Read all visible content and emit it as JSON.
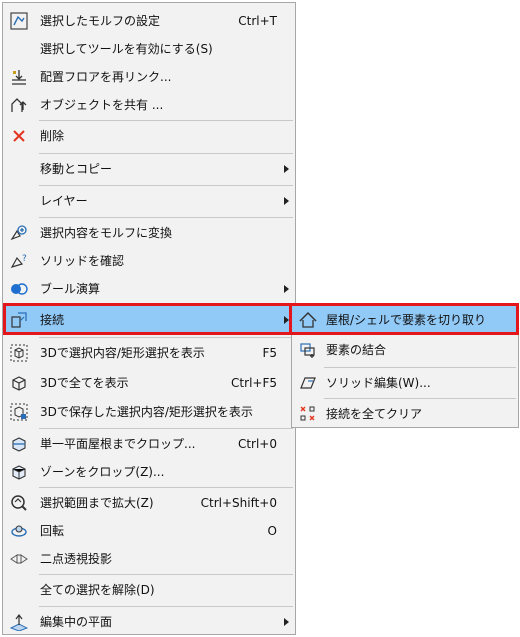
{
  "menu": {
    "items": [
      {
        "label": "選択したモルフの設定",
        "shortcut": "Ctrl+T",
        "icon": "morph-settings-icon"
      },
      {
        "label": "選択してツールを有効にする(S)",
        "shortcut": "",
        "icon": ""
      },
      {
        "label": "配置フロアを再リンク...",
        "shortcut": "",
        "icon": "relink-floor-icon"
      },
      {
        "label": "オブジェクトを共有 ...",
        "shortcut": "",
        "icon": "share-object-icon"
      },
      {
        "label": "削除",
        "shortcut": "",
        "icon": "delete-icon"
      },
      {
        "label": "移動とコピー",
        "shortcut": "",
        "icon": ""
      },
      {
        "label": "レイヤー",
        "shortcut": "",
        "icon": ""
      },
      {
        "label": "選択内容をモルフに変換",
        "shortcut": "",
        "icon": "convert-morph-icon"
      },
      {
        "label": "ソリッドを確認",
        "shortcut": "",
        "icon": "check-solid-icon"
      },
      {
        "label": "ブール演算",
        "shortcut": "",
        "icon": "boolean-icon"
      },
      {
        "label": "接続",
        "shortcut": "",
        "icon": "connect-icon"
      },
      {
        "label": "3Dで選択内容/矩形選択を表示",
        "shortcut": "F5",
        "icon": "3d-selection-icon"
      },
      {
        "label": "3Dで全てを表示",
        "shortcut": "Ctrl+F5",
        "icon": "3d-all-icon"
      },
      {
        "label": "3Dで保存した選択内容/矩形選択を表示",
        "shortcut": "",
        "icon": "3d-saved-selection-icon"
      },
      {
        "label": "単一平面屋根までクロップ...",
        "shortcut": "Ctrl+0",
        "icon": "crop-roof-icon"
      },
      {
        "label": "ゾーンをクロップ(Z)...",
        "shortcut": "",
        "icon": "crop-zone-icon"
      },
      {
        "label": "選択範囲まで拡大(Z)",
        "shortcut": "Ctrl+Shift+0",
        "icon": "zoom-selection-icon"
      },
      {
        "label": "回転",
        "shortcut": "O",
        "icon": "rotate-icon"
      },
      {
        "label": "二点透視投影",
        "shortcut": "",
        "icon": "two-point-perspective-icon"
      },
      {
        "label": "全ての選択を解除(D)",
        "shortcut": "",
        "icon": ""
      },
      {
        "label": "編集中の平面",
        "shortcut": "",
        "icon": "editing-plane-icon"
      }
    ]
  },
  "submenu": {
    "items": [
      {
        "label": "屋根/シェルで要素を切り取り",
        "icon": "trim-roof-shell-icon"
      },
      {
        "label": "要素の結合",
        "icon": "merge-elements-icon"
      },
      {
        "label": "ソリッド編集(W)...",
        "icon": "solid-edit-icon"
      },
      {
        "label": "接続を全てクリア",
        "icon": "clear-connections-icon"
      }
    ]
  },
  "colors": {
    "highlight": "#91c9f7",
    "red_outline": "#e3161b",
    "menu_bg": "#f2f2f2"
  }
}
